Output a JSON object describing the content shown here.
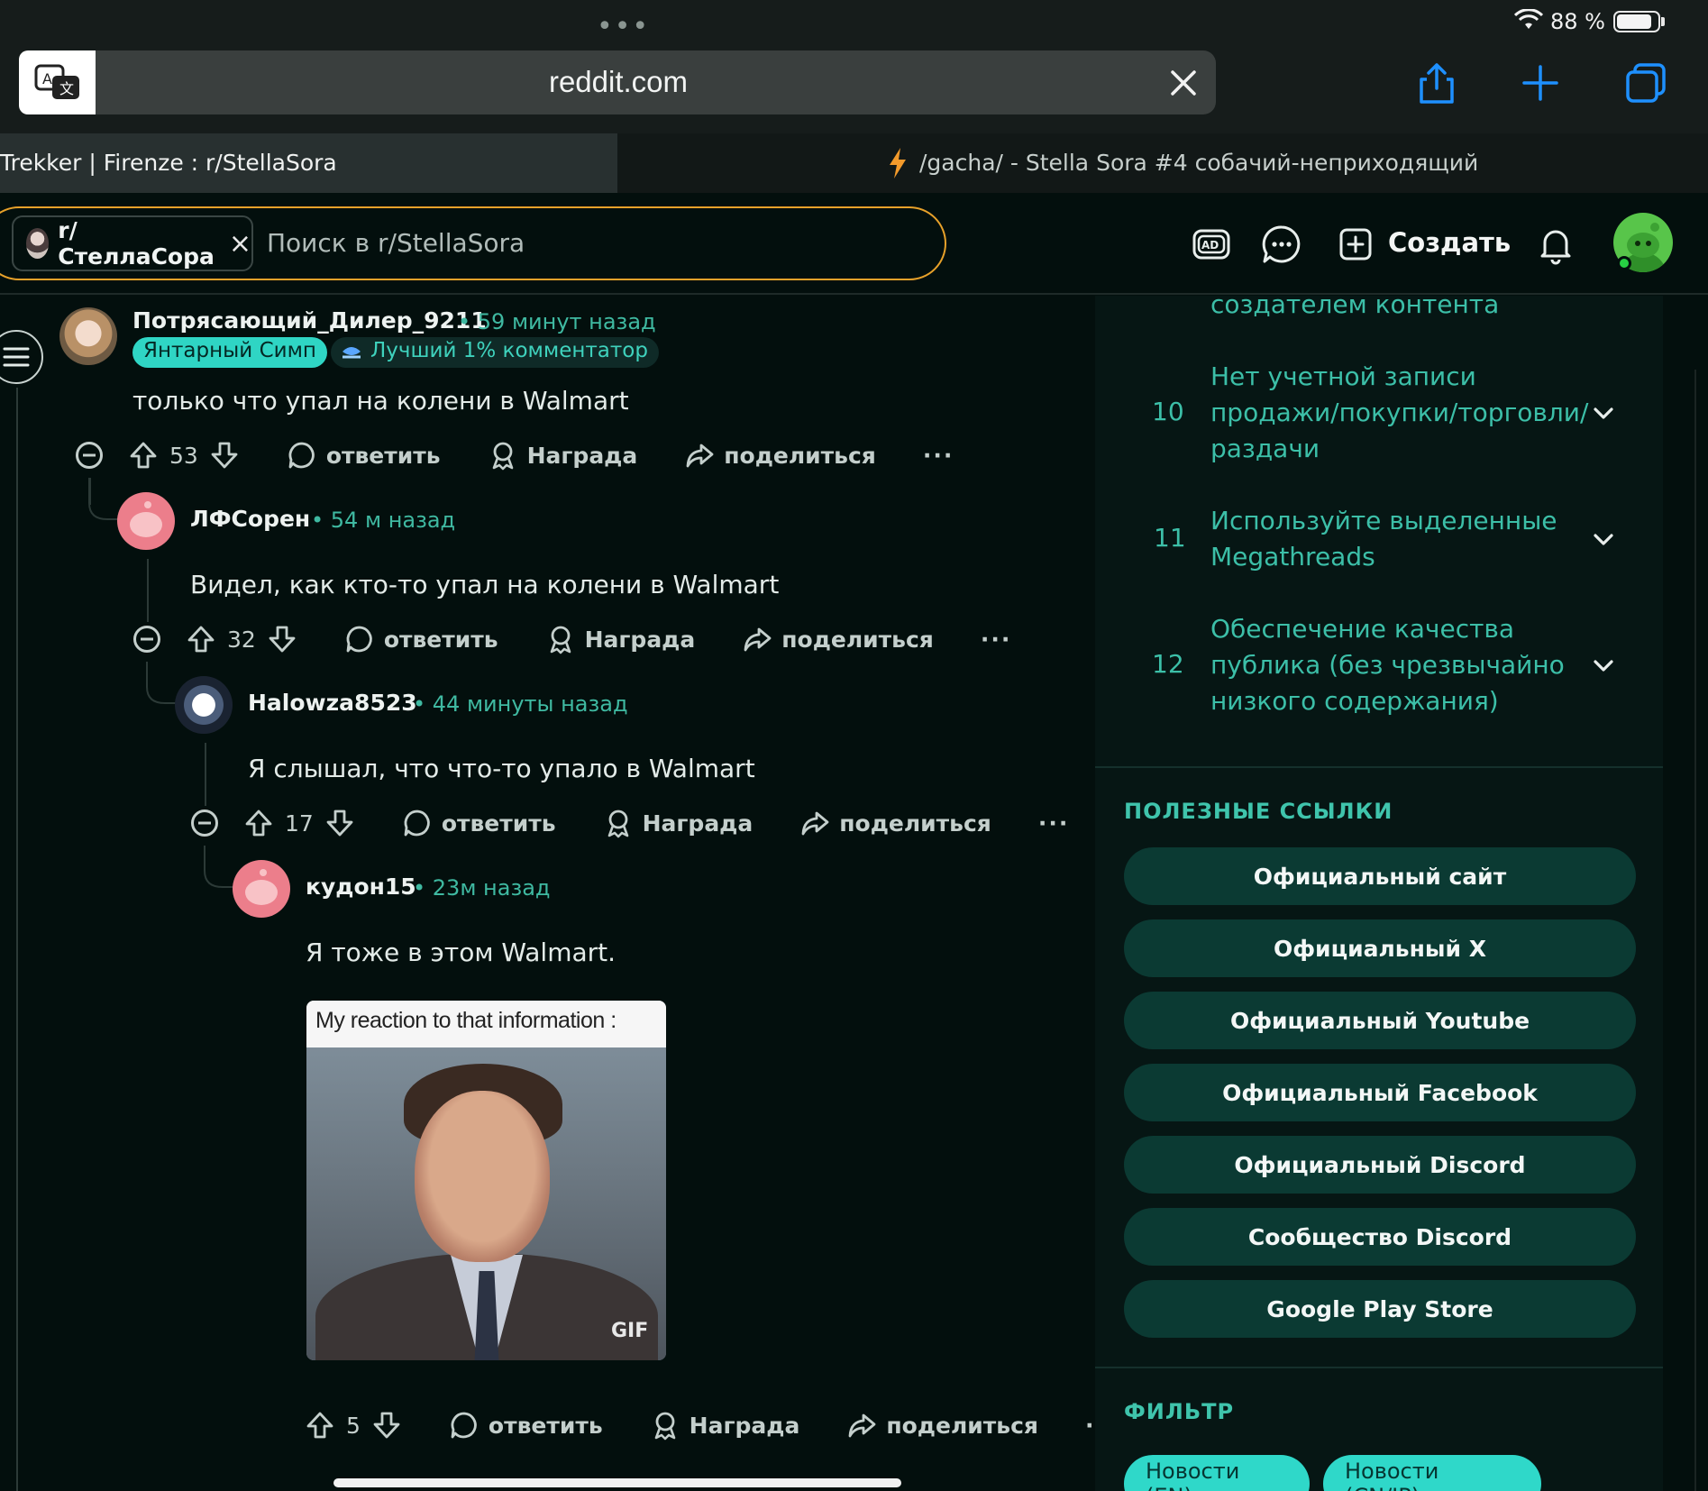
{
  "status": {
    "battery_pct": "88 %",
    "dots": "•••"
  },
  "browser": {
    "url": "reddit.com",
    "tabs": [
      {
        "label": "Trekker | Firenze : r/StellaSora",
        "active": true
      },
      {
        "label": "/gacha/ - Stella Sora #4 собачий-неприходящий",
        "active": false
      }
    ]
  },
  "header": {
    "community_chip": "r/СтеллаСора",
    "search_placeholder": "Поиск в r/StellaSora",
    "create_label": "Создать"
  },
  "comments": [
    {
      "user": "Потрясающий_Дилер_9211",
      "time": "• 59 минут назад",
      "flairs": [
        "Янтарный Симп",
        "Лучший 1% комментатор"
      ],
      "text": "только что упал на колени в Walmart",
      "score": "53"
    },
    {
      "user": "ЛФСорен",
      "time": "• 54 м назад",
      "text": "Видел, как кто-то упал на колени в Walmart",
      "score": "32"
    },
    {
      "user": "Halowza8523",
      "time": "• 44 минуты назад",
      "text": "Я слышал, что что-то упало в Walmart",
      "score": "17"
    },
    {
      "user": "кудон15",
      "time": "• 23м назад",
      "text": "Я тоже в этом Walmart.",
      "gif_caption": "My reaction to that information :",
      "gif_badge": "GIF",
      "score": "5"
    }
  ],
  "actions": {
    "reply": "ответить",
    "award": "Награда",
    "share": "поделиться",
    "more": "···"
  },
  "sidebar": {
    "rule_fragment": "создателем контента",
    "rules": [
      {
        "num": "10",
        "lines": [
          "Нет учетной записи",
          "продажи/покупки/торговли/",
          "раздачи"
        ]
      },
      {
        "num": "11",
        "lines": [
          "Используйте выделенные",
          "Megathreads"
        ]
      },
      {
        "num": "12",
        "lines": [
          "Обеспечение качества",
          "публика (без чрезвычайно",
          "низкого содержания)"
        ]
      }
    ],
    "links_heading": "ПОЛЕЗНЫЕ ССЫЛКИ",
    "links": [
      "Официальный сайт",
      "Официальный X",
      "Официальный Youtube",
      "Официальный Facebook",
      "Официальный Discord",
      "Сообщество Discord",
      "Google Play Store"
    ],
    "filter_heading": "ФИЛЬТР",
    "filters": [
      "Новости (EN)",
      "Новости (CN/JP)"
    ]
  },
  "colors": {
    "accent": "#3fb9a1",
    "search_border": "#e7a12a",
    "link_button": "#0b3a33",
    "filter_pill": "#2fd8c9"
  }
}
